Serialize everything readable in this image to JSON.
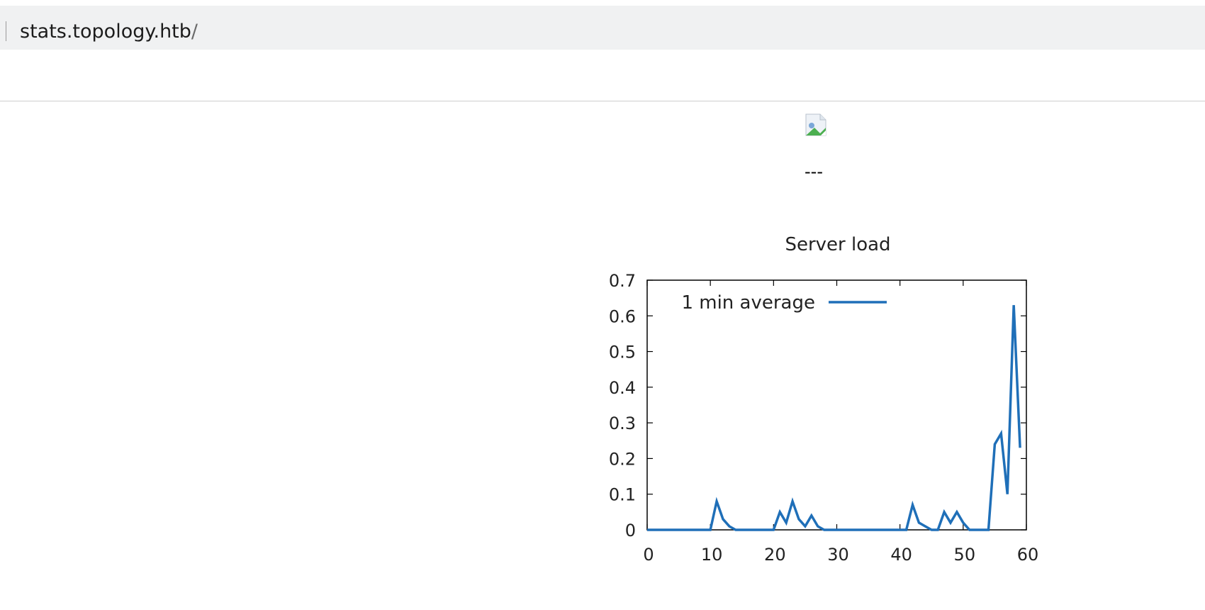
{
  "browser": {
    "url_host": "stats.topology.htb",
    "url_path": "/"
  },
  "page": {
    "broken_image_icon": "broken-image-icon",
    "separator_text": "---"
  },
  "chart_data": {
    "type": "line",
    "title": "Server load",
    "xlabel": "",
    "ylabel": "",
    "xlim": [
      0,
      60
    ],
    "ylim": [
      0,
      0.7
    ],
    "x_ticks": [
      0,
      10,
      20,
      30,
      40,
      50,
      60
    ],
    "y_ticks": [
      0,
      0.1,
      0.2,
      0.3,
      0.4,
      0.5,
      0.6,
      0.7
    ],
    "y_tick_labels": [
      "0",
      "0.1",
      "0.2",
      "0.3",
      "0.4",
      "0.5",
      "0.6",
      "0.7"
    ],
    "legend_position": "top-left",
    "grid": false,
    "series": [
      {
        "name": "1 min average",
        "color": "#1f6fb8",
        "x": [
          0,
          1,
          2,
          3,
          4,
          5,
          6,
          7,
          8,
          9,
          10,
          11,
          12,
          13,
          14,
          15,
          16,
          17,
          18,
          19,
          20,
          21,
          22,
          23,
          24,
          25,
          26,
          27,
          28,
          29,
          30,
          31,
          32,
          33,
          34,
          35,
          36,
          37,
          38,
          39,
          40,
          41,
          42,
          43,
          44,
          45,
          46,
          47,
          48,
          49,
          50,
          51,
          52,
          53,
          54,
          55,
          56,
          57,
          58,
          59
        ],
        "y": [
          0,
          0,
          0,
          0,
          0,
          0,
          0,
          0,
          0,
          0,
          0,
          0.08,
          0.03,
          0.01,
          0,
          0,
          0,
          0,
          0,
          0,
          0,
          0.05,
          0.02,
          0.08,
          0.03,
          0.01,
          0.04,
          0.01,
          0,
          0,
          0,
          0,
          0,
          0,
          0,
          0,
          0,
          0,
          0,
          0,
          0,
          0,
          0.07,
          0.02,
          0.01,
          0,
          0,
          0.05,
          0.02,
          0.05,
          0.02,
          0,
          0,
          0,
          0,
          0.24,
          0.27,
          0.1,
          0.63,
          0.23
        ]
      }
    ]
  }
}
